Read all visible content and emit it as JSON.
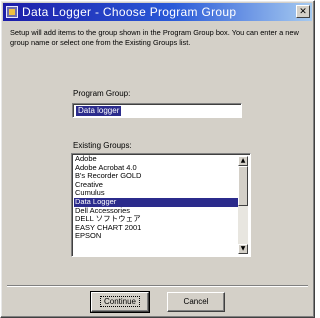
{
  "window": {
    "title": "Data Logger - Choose Program Group",
    "close_glyph": "✕"
  },
  "intro_text": "Setup will add items to the group shown in the Program Group box. You can enter a new group name or select one from the Existing Groups list.",
  "program_group": {
    "label": "Program Group:",
    "value": "Data logger"
  },
  "existing_groups": {
    "label": "Existing Groups:",
    "items": [
      "Adobe",
      "Adobe Acrobat 4.0",
      "B's Recorder GOLD",
      "Creative",
      "Cumulus",
      "Data Logger",
      "Dell Accessories",
      "DELL ソフトウェア",
      "EASY CHART 2001",
      "EPSON"
    ],
    "selected_index": 5,
    "scroll_up_glyph": "▲",
    "scroll_down_glyph": "▼"
  },
  "buttons": {
    "continue": "Continue",
    "cancel": "Cancel"
  },
  "colors": {
    "title_bar_start": "#1c1ca8",
    "title_bar_end": "#a6caf0",
    "selection": "#2b2b8c",
    "face": "#d4d0c8"
  },
  "icons": {
    "app": "data-logger-app-icon",
    "close": "close-icon"
  }
}
